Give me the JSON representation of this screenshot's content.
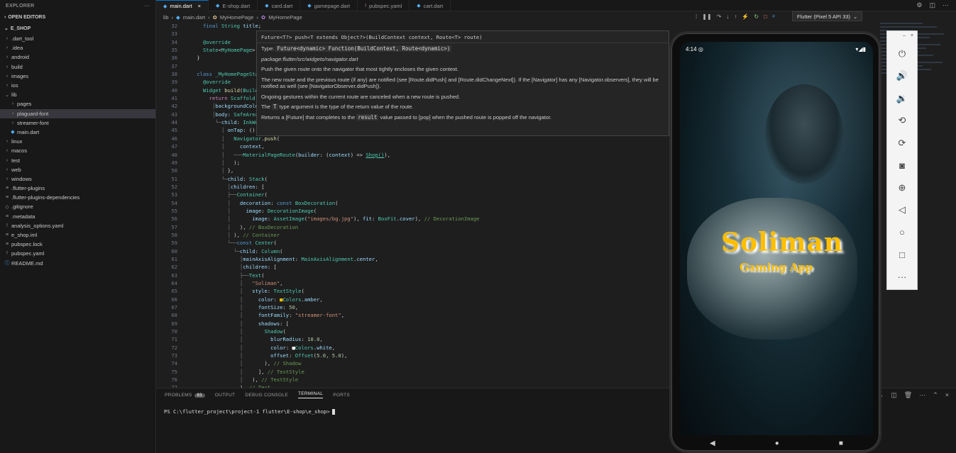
{
  "sidebar": {
    "title": "EXPLORER",
    "more": "···",
    "open_editors": "OPEN EDITORS",
    "project": "E_SHOP",
    "items": [
      {
        "label": ".dart_tool",
        "type": "folder",
        "depth": 1
      },
      {
        "label": ".idea",
        "type": "folder",
        "depth": 1
      },
      {
        "label": "android",
        "type": "folder",
        "depth": 1
      },
      {
        "label": "build",
        "type": "folder",
        "depth": 1
      },
      {
        "label": "images",
        "type": "folder",
        "depth": 1
      },
      {
        "label": "ios",
        "type": "folder",
        "depth": 1
      },
      {
        "label": "lib",
        "type": "folder-open",
        "depth": 1
      },
      {
        "label": "pages",
        "type": "folder",
        "depth": 2
      },
      {
        "label": "plaguard-font",
        "type": "folder",
        "depth": 2,
        "selected": true
      },
      {
        "label": "streamer-font",
        "type": "folder",
        "depth": 2
      },
      {
        "label": "main.dart",
        "type": "dart",
        "depth": 2
      },
      {
        "label": "linux",
        "type": "folder",
        "depth": 1
      },
      {
        "label": "macos",
        "type": "folder",
        "depth": 1
      },
      {
        "label": "test",
        "type": "folder",
        "depth": 1
      },
      {
        "label": "web",
        "type": "folder",
        "depth": 1
      },
      {
        "label": "windows",
        "type": "folder",
        "depth": 1
      },
      {
        "label": ".flutter-plugins",
        "type": "file",
        "depth": 1
      },
      {
        "label": ".flutter-plugins-dependencies",
        "type": "file",
        "depth": 1
      },
      {
        "label": ".gitignore",
        "type": "git",
        "depth": 1
      },
      {
        "label": ".metadata",
        "type": "file",
        "depth": 1
      },
      {
        "label": "analysis_options.yaml",
        "type": "yaml",
        "depth": 1
      },
      {
        "label": "e_shop.iml",
        "type": "xml",
        "depth": 1
      },
      {
        "label": "pubspec.lock",
        "type": "lock",
        "depth": 1
      },
      {
        "label": "pubspec.yaml",
        "type": "yaml",
        "depth": 1
      },
      {
        "label": "README.md",
        "type": "info",
        "depth": 1
      }
    ]
  },
  "tabs": [
    {
      "label": "main.dart",
      "active": true,
      "close": "×"
    },
    {
      "label": "E-shop.dart"
    },
    {
      "label": "card.dart"
    },
    {
      "label": "gamepage.dart"
    },
    {
      "label": "pubspec.yaml"
    },
    {
      "label": "cart.dart"
    }
  ],
  "breadcrumb": [
    "lib",
    "main.dart",
    "MyHomePage",
    "MyHomePage"
  ],
  "device": "Flutter (Pixel 5 API 33)",
  "hover": {
    "signature": "Future<T?> push<T extends Object?>(BuildContext context, Route<T> route)",
    "type_label": "Type:",
    "type": "Future<dynamic> Function(BuildContext, Route<dynamic>)",
    "path": "package:flutter/src/widgets/navigator.dart",
    "p1": "Push the given route onto the navigator that most tightly encloses the given context.",
    "p2": "The new route and the previous route (if any) are notified (see [Route.didPush] and [Route.didChangeNext]). If the [Navigator] has any [Navigator.observers], they will be notified as well (see [NavigatorObserver.didPush]).",
    "p3": "Ongoing gestures within the current route are canceled when a new route is pushed.",
    "p4_pre": "The",
    "p4_code": "T",
    "p4_post": "type argument is the type of the return value of the route.",
    "p5_pre": "Returns a [Future] that completes to the",
    "p5_code": "result",
    "p5_post": "value passed to [pop] when the pushed route is popped off the navigator."
  },
  "panel": {
    "tabs": [
      "PROBLEMS",
      "OUTPUT",
      "DEBUG CONSOLE",
      "TERMINAL",
      "PORTS"
    ],
    "problems_count": "83",
    "prompt": "PS C:\\flutter_project\\project-1 flutter\\E-shop\\e_shop>"
  },
  "phone": {
    "time": "4:14",
    "title": "Soliman",
    "subtitle": "Gaming App"
  },
  "colors": {
    "accent": "#0078d4",
    "amber": "#ffbf00",
    "bg": "#1e1e1e"
  }
}
